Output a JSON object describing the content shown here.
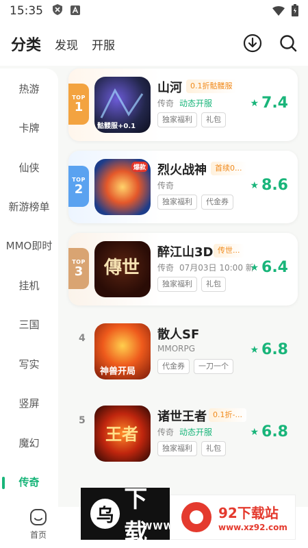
{
  "status_bar": {
    "time": "15:35"
  },
  "top_nav": {
    "tabs": [
      "分类",
      "发现",
      "开服"
    ]
  },
  "sidebar": {
    "categories": [
      "热游",
      "卡牌",
      "仙侠",
      "新游榜单",
      "MMO即时",
      "挂机",
      "三国",
      "写实",
      "竖屏",
      "魔幻",
      "传奇"
    ],
    "active": "传奇"
  },
  "games": [
    {
      "rank_label": "TOP",
      "rank": "1",
      "name": "山河",
      "promo": "0.1折骷髅服",
      "genre": "传奇",
      "server": "动态开服",
      "date": "",
      "tags": [
        "独家福利",
        "礼包"
      ],
      "score": "7.4",
      "icon_text": "骷髅服+0.1",
      "badge_color": "#f3a340"
    },
    {
      "rank_label": "TOP",
      "rank": "2",
      "name": "烈火战神",
      "promo": "首续0...",
      "genre": "传奇",
      "server": "",
      "date": "",
      "tags": [
        "独家福利",
        "代金券"
      ],
      "score": "8.6",
      "icon_text": "爆款",
      "badge_color": "#5aa2f0"
    },
    {
      "rank_label": "TOP",
      "rank": "3",
      "name": "醉江山3D",
      "promo": "传世...",
      "genre": "传奇",
      "server": "",
      "date": "07月03日 10:00 新",
      "tags": [
        "独家福利",
        "礼包"
      ],
      "score": "6.4",
      "icon_text": "傳世",
      "badge_color": "#d9a472"
    },
    {
      "rank_label": "",
      "rank": "4",
      "name": "散人SF",
      "promo": "",
      "genre": "MMORPG",
      "server": "",
      "date": "",
      "tags": [
        "代金券",
        "一刀一个"
      ],
      "score": "6.8",
      "icon_text": "神兽开局"
    },
    {
      "rank_label": "",
      "rank": "5",
      "name": "诸世王者",
      "promo": "0.1折-...",
      "genre": "传奇",
      "server": "动态开服",
      "date": "",
      "tags": [
        "独家福利",
        "礼包"
      ],
      "score": "6.8",
      "icon_text": "王者"
    }
  ],
  "bottom_nav": {
    "home_label": "首页"
  },
  "watermarks": {
    "left": {
      "glyph": "乌",
      "text": "下载",
      "sub": "WWW"
    },
    "right": {
      "brand": "92下载站",
      "url": "www.xz92.com"
    }
  },
  "colors": {
    "accent": "#19b57a",
    "promo": "#f08a1c"
  }
}
